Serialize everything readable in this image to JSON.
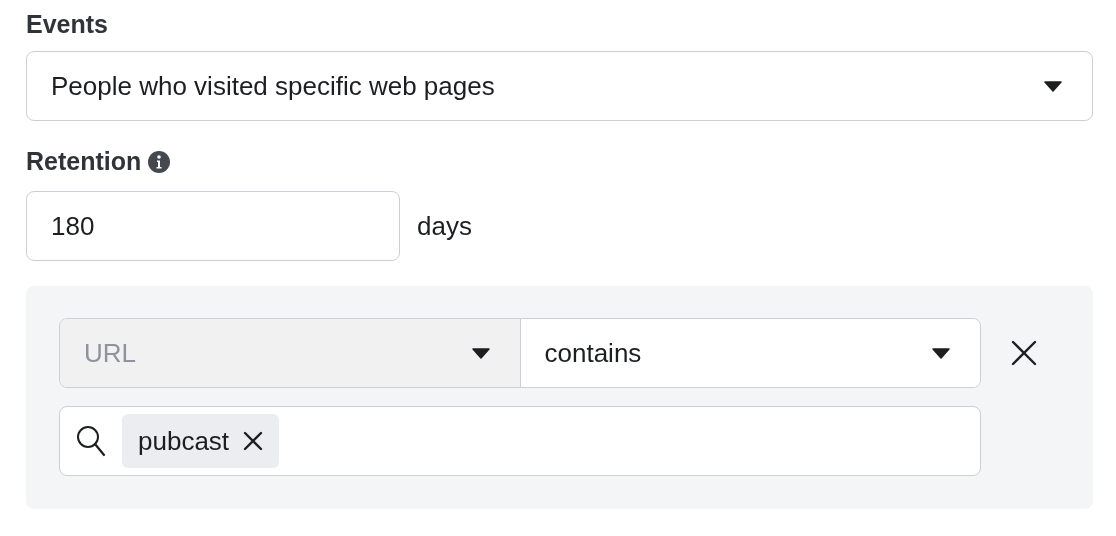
{
  "events": {
    "label": "Events",
    "value": "People who visited specific web pages"
  },
  "retention": {
    "label": "Retention",
    "value": "180",
    "unit": "days"
  },
  "rule": {
    "field": {
      "value": "URL",
      "disabled": true
    },
    "operator": {
      "value": "contains",
      "disabled": false
    },
    "tags": [
      {
        "label": "pubcast"
      }
    ]
  }
}
